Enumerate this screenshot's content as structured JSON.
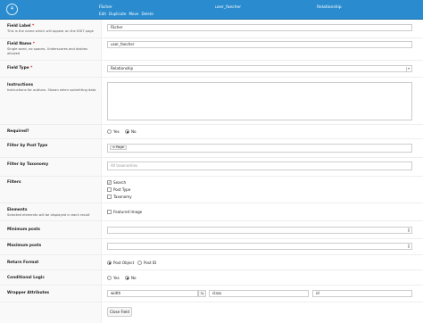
{
  "header": {
    "order": "4",
    "label": "Fächer",
    "name": "user_faecher",
    "type": "Relationship",
    "actions": [
      "Edit",
      "Duplicate",
      "Move",
      "Delete"
    ]
  },
  "rows": {
    "field_label": {
      "label": "Field Label",
      "required": "*",
      "desc": "This is the name which will appear on the EDIT page",
      "value": "Fächer"
    },
    "field_name": {
      "label": "Field Name",
      "required": "*",
      "desc": "Single word, no spaces. Underscores and dashes allowed",
      "value": "user_faecher"
    },
    "field_type": {
      "label": "Field Type",
      "required": "*",
      "value": "Relationship"
    },
    "instructions": {
      "label": "Instructions",
      "desc": "Instructions for authors. Shown when submitting data"
    },
    "required": {
      "label": "Required?",
      "options": [
        "Yes",
        "No"
      ],
      "selected": "No"
    },
    "filter_post_type": {
      "label": "Filter by Post Type",
      "tag": "Page"
    },
    "filter_taxonomy": {
      "label": "Filter by Taxonomy",
      "placeholder": "All taxonomies"
    },
    "filters": {
      "label": "Filters",
      "options": [
        {
          "label": "Search",
          "checked": true
        },
        {
          "label": "Post Type",
          "checked": false
        },
        {
          "label": "Taxonomy",
          "checked": false
        }
      ]
    },
    "elements": {
      "label": "Elements",
      "desc": "Selected elements will be displayed in each result",
      "option": "Featured Image",
      "checked": false
    },
    "min_posts": {
      "label": "Minimum posts"
    },
    "max_posts": {
      "label": "Maximum posts"
    },
    "return_format": {
      "label": "Return Format",
      "options": [
        "Post Object",
        "Post ID"
      ],
      "selected": "Post Object"
    },
    "conditional_logic": {
      "label": "Conditional Logic",
      "options": [
        "Yes",
        "No"
      ],
      "selected": "No"
    },
    "wrapper": {
      "label": "Wrapper Attributes",
      "width": "width",
      "unit": "%",
      "class": "class",
      "id": "id"
    }
  },
  "close_button": "Close Field"
}
